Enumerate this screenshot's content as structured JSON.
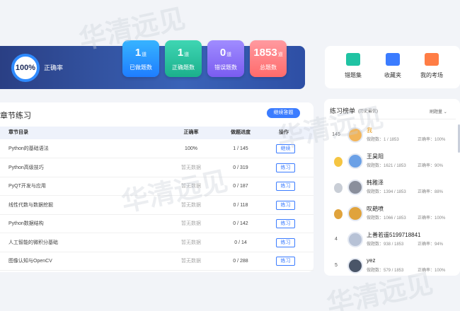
{
  "stats": {
    "accuracy": "100%",
    "accuracy_label": "正确率",
    "cards": [
      {
        "num": "1",
        "unit": "道",
        "label": "已做题数"
      },
      {
        "num": "1",
        "unit": "道",
        "label": "正确题数"
      },
      {
        "num": "0",
        "unit": "道",
        "label": "错误题数"
      },
      {
        "num": "1853",
        "unit": "道",
        "label": "总题数"
      }
    ]
  },
  "tiles": [
    {
      "label": "错题集",
      "icon": "wrong-questions-icon",
      "color": "#20c3a3"
    },
    {
      "label": "收藏夹",
      "icon": "favorites-folder-icon",
      "color": "#3b7cff"
    },
    {
      "label": "我的考场",
      "icon": "my-exam-icon",
      "color": "#ff7d45"
    }
  ],
  "chapters": {
    "title": "章节练习",
    "continue_label": "继续答题",
    "headers": [
      "章节目录",
      "正确率",
      "做题进度",
      "操作"
    ],
    "rows": [
      {
        "name": "Python的基础语法",
        "rate": "100%",
        "progress": "1 / 145",
        "action": "继续"
      },
      {
        "name": "Python高级技巧",
        "rate": "暂无数据",
        "progress": "0 / 319",
        "action": "练习"
      },
      {
        "name": "PyQT开发与应用",
        "rate": "暂无数据",
        "progress": "0 / 187",
        "action": "练习"
      },
      {
        "name": "线性代数与数据挖掘",
        "rate": "暂无数据",
        "progress": "0 / 118",
        "action": "练习"
      },
      {
        "name": "Python数据结构",
        "rate": "暂无数据",
        "progress": "0 / 142",
        "action": "练习"
      },
      {
        "name": "人工智能的微积分基础",
        "rate": "暂无数据",
        "progress": "0 / 14",
        "action": "练习"
      },
      {
        "name": "图像认知与OpenCV",
        "rate": "暂无数据",
        "progress": "0 / 288",
        "action": "练习"
      }
    ]
  },
  "ranking": {
    "title": "练习榜单",
    "subtitle": "(历史最优)",
    "sort": "刷题量",
    "items": [
      {
        "pos": "145",
        "name": "我",
        "done": "做题数：1 / 1853",
        "rate": "正确率：100%"
      },
      {
        "pos": "",
        "name": "王昊阳",
        "done": "做题数：1621 / 1853",
        "rate": "正确率：90%"
      },
      {
        "pos": "",
        "name": "韩雅泽",
        "done": "做题数：1394 / 1853",
        "rate": "正确率：88%"
      },
      {
        "pos": "",
        "name": "叹葩喷",
        "done": "做题数：1066 / 1853",
        "rate": "正确率：100%"
      },
      {
        "pos": "4",
        "name": "上善若遥5199718841",
        "done": "做题数：938 / 1853",
        "rate": "正确率：94%"
      },
      {
        "pos": "5",
        "name": "yez",
        "done": "做题数：579 / 1853",
        "rate": "正确率：100%"
      }
    ]
  },
  "watermark": "华清远见"
}
